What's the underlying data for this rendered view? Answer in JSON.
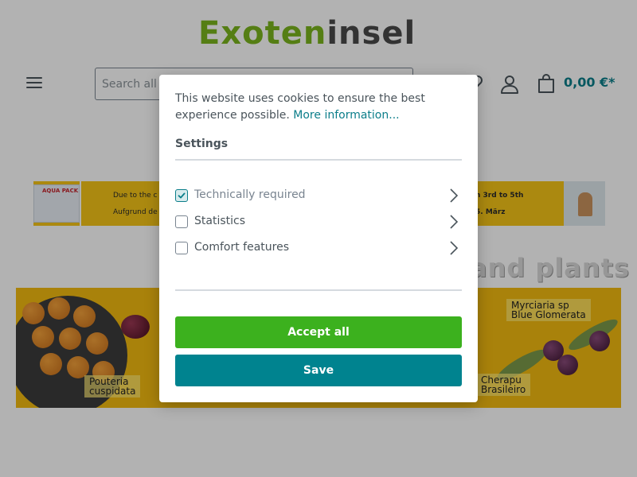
{
  "header": {
    "logo_part1": "Exoten",
    "logo_part2": "insel",
    "search_placeholder": "Search all categories...",
    "cart_total": "0,00 €*"
  },
  "icons": {
    "menu": "hamburger-menu-icon",
    "search": "search-icon",
    "wishlist": "heart-icon",
    "account": "user-icon",
    "cart": "shopping-bag-icon",
    "chevron": "chevron-right-icon",
    "check": "check-icon"
  },
  "notice_banner": {
    "pack_label": "AQUA PACK",
    "left_line1": "Due to the c",
    "left_line2": "Aufgrund de",
    "right_line1": "h 3rd to 5th",
    "right_line2": "5. März"
  },
  "section_heading_visible": "and plants",
  "fruit_banner": {
    "label_left": "Pouteria\ncuspidata",
    "label_right_top": "Myrciaria sp\nBlue Glomerata",
    "label_right_bottom": "Cherapu\nBrasileiro"
  },
  "cookie_modal": {
    "intro_text": "This website uses cookies to ensure the best experience possible.",
    "more_info_link": "More information...",
    "settings_title": "Settings",
    "options": [
      {
        "label": "Technically required",
        "checked": true,
        "disabled": true
      },
      {
        "label": "Statistics",
        "checked": false,
        "disabled": false
      },
      {
        "label": "Comfort features",
        "checked": false,
        "disabled": false
      }
    ],
    "accept_all_label": "Accept all",
    "save_label": "Save"
  },
  "colors": {
    "brand_green": "#7ab51d",
    "accent_teal": "#0b7e8a",
    "accept_green": "#3cb11e",
    "save_teal": "#00838f",
    "banner_yellow": "#f3bb10"
  }
}
